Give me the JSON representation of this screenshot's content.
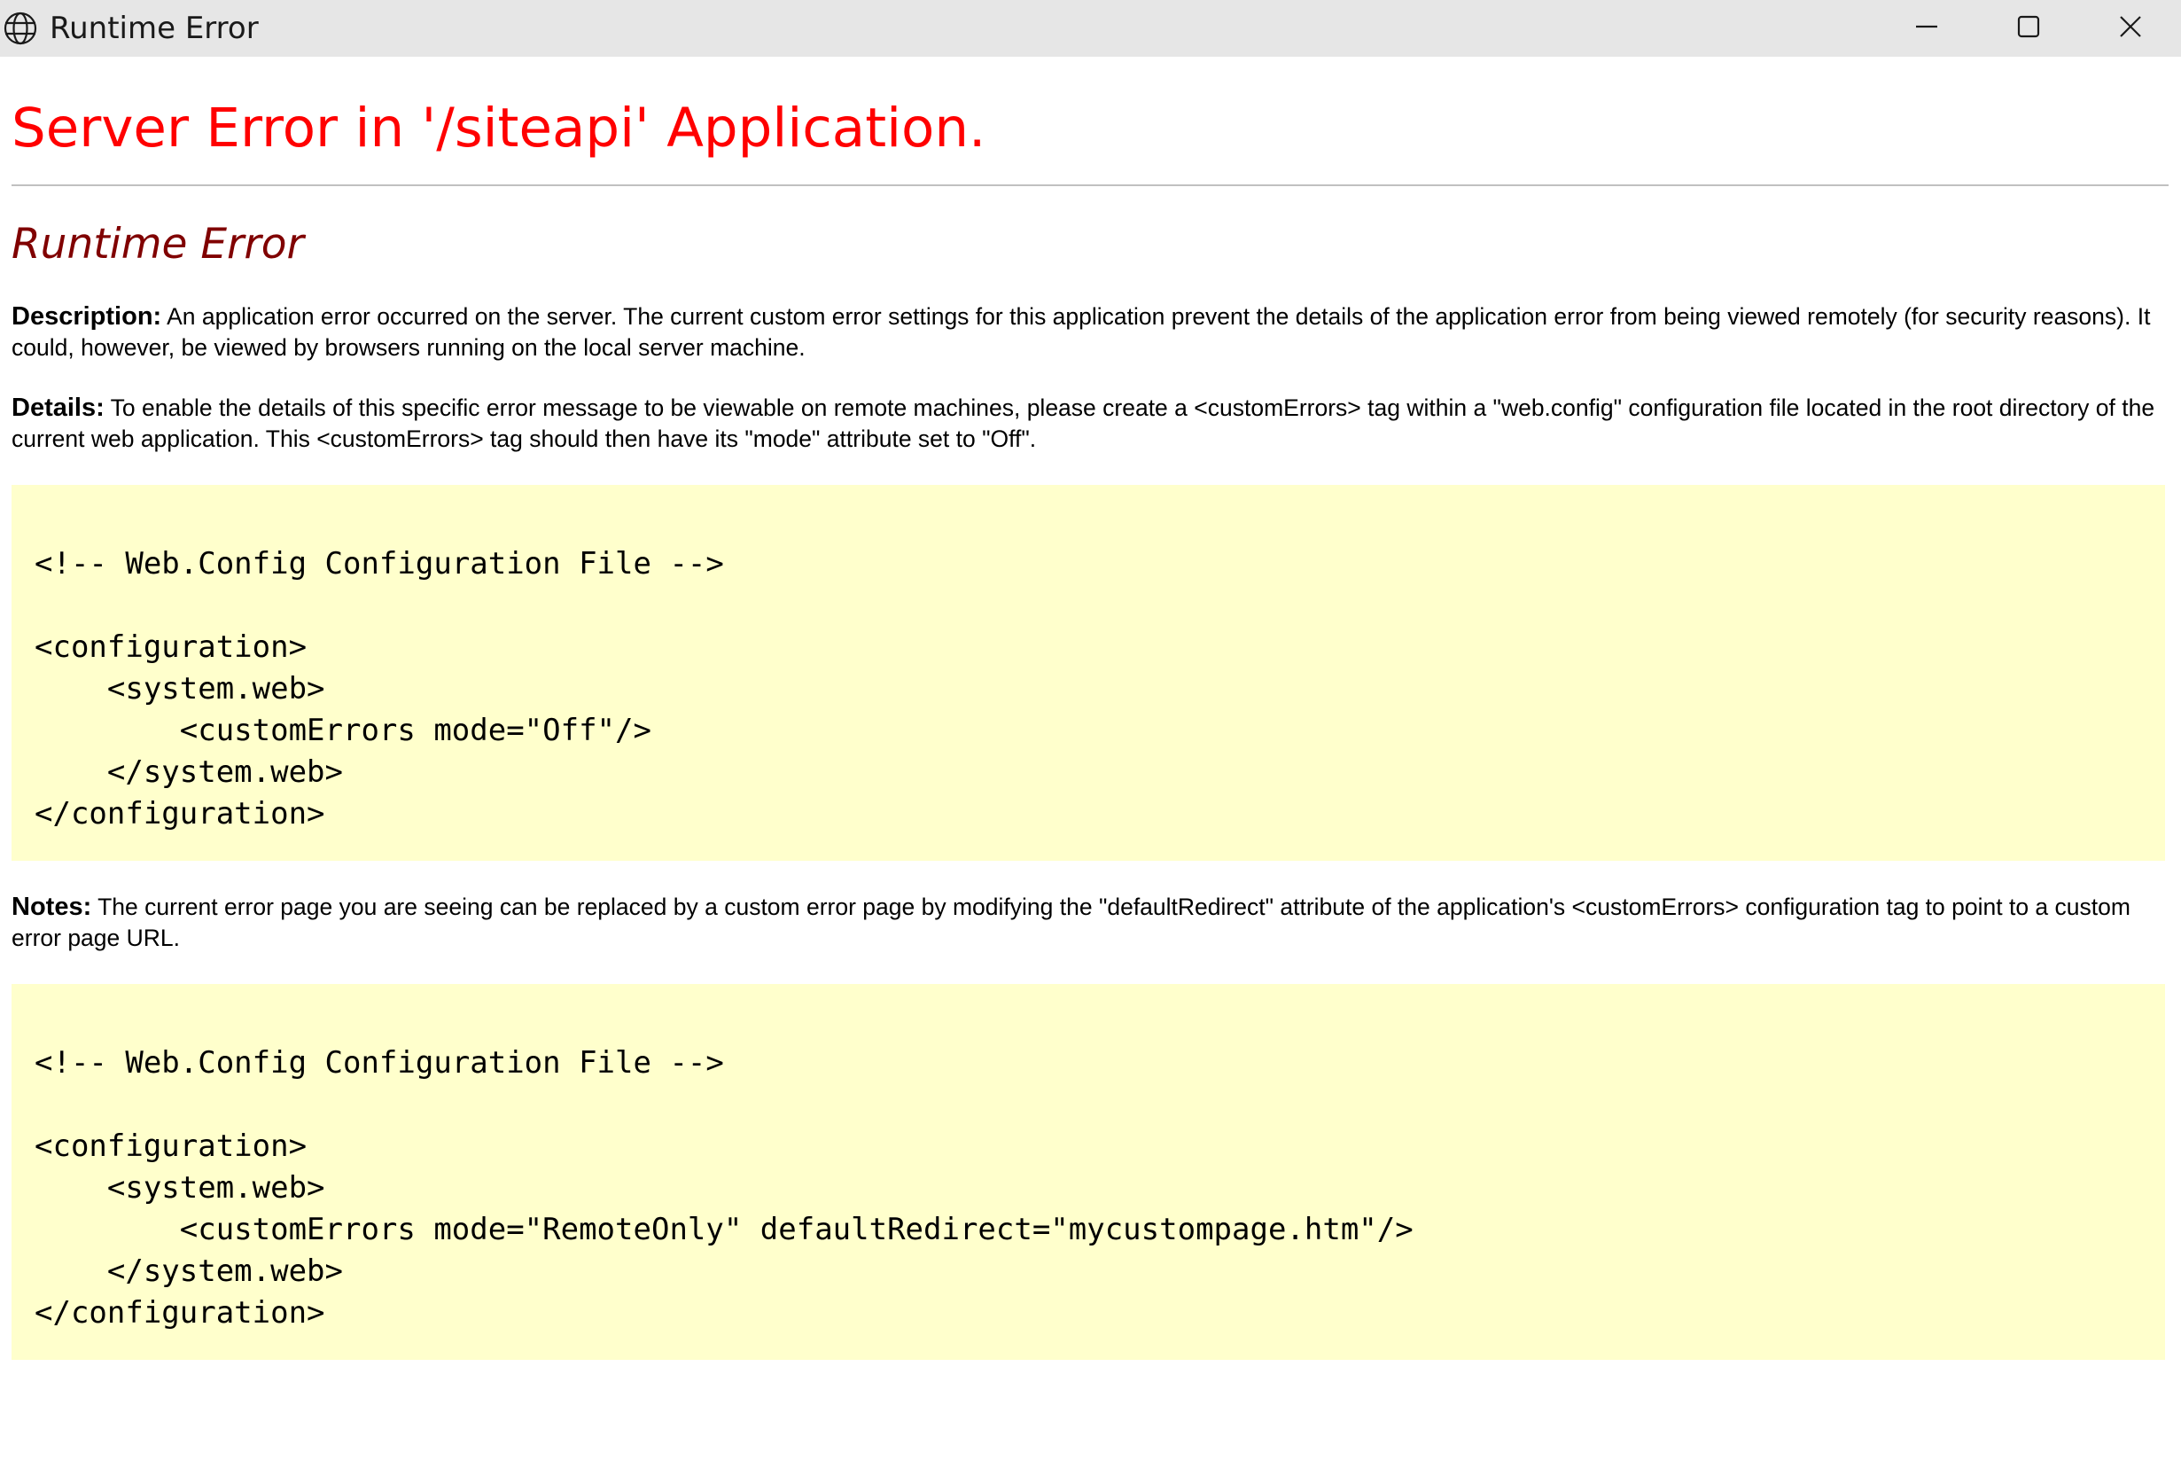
{
  "window": {
    "title": "Runtime Error",
    "icon": "globe-icon",
    "controls": [
      "minimize-icon",
      "maximize-icon",
      "close-icon"
    ]
  },
  "page": {
    "title": "Server Error in '/siteapi' Application.",
    "subtitle": "Runtime Error",
    "description_label": "Description:",
    "description_text": " An application error occurred on the server. The current custom error settings for this application prevent the details of the application error from being viewed remotely (for security reasons). It could, however, be viewed by browsers running on the local server machine.",
    "details_label": "Details:",
    "details_text": " To enable the details of this specific error message to be viewable on remote machines, please create a <customErrors> tag within a \"web.config\" configuration file located in the root directory of the current web application. This <customErrors> tag should then have its \"mode\" attribute set to \"Off\".",
    "code1": [
      "<!-- Web.Config Configuration File -->",
      "",
      "<configuration>",
      "    <system.web>",
      "        <customErrors mode=\"Off\"/>",
      "    </system.web>",
      "</configuration>"
    ],
    "notes_label": "Notes:",
    "notes_text": " The current error page you are seeing can be replaced by a custom error page by modifying the \"defaultRedirect\" attribute of the application's <customErrors> configuration tag to point to a custom error page URL.",
    "code2": [
      "<!-- Web.Config Configuration File -->",
      "",
      "<configuration>",
      "    <system.web>",
      "        <customErrors mode=\"RemoteOnly\" defaultRedirect=\"mycustompage.htm\"/>",
      "    </system.web>",
      "</configuration>"
    ]
  },
  "colors": {
    "title": "#ff0000",
    "subtitle": "#800000",
    "code_background": "#ffffcc",
    "titlebar": "#e6e6e6"
  }
}
